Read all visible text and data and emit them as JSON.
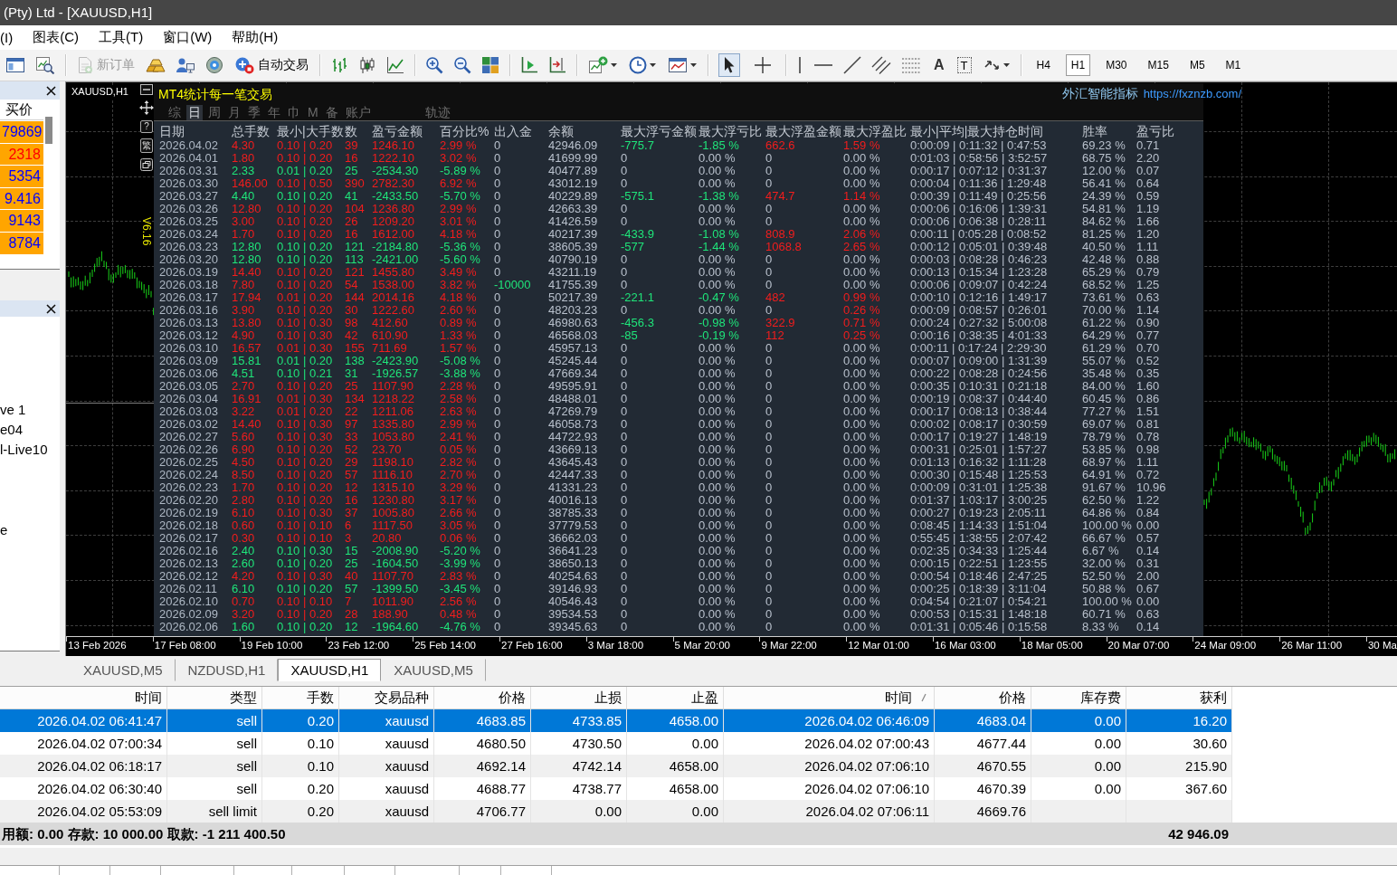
{
  "window": {
    "title": "(Pty) Ltd - [XAUUSD,H1]"
  },
  "menu": [
    "(I)",
    "图表(C)",
    "工具(T)",
    "窗口(W)",
    "帮助(H)"
  ],
  "toolbar": {
    "new_order": {
      "label": "新订单",
      "disabled": true
    },
    "auto_trading": "自动交易",
    "pointer_modes": [
      {
        "selected": true
      },
      {
        "selected": false
      }
    ],
    "text_tool": "A",
    "label_tool": "T",
    "timeframes": [
      {
        "label": "H4",
        "selected": false
      },
      {
        "label": "H1",
        "selected": true
      },
      {
        "label": "M30",
        "selected": false
      },
      {
        "label": "M15",
        "selected": false
      },
      {
        "label": "M5",
        "selected": false
      },
      {
        "label": "M1",
        "selected": false
      }
    ]
  },
  "market_watch": {
    "column": "买价",
    "rows": [
      {
        "bid": "79869",
        "kind": "up"
      },
      {
        "bid": "2318",
        "kind": "down"
      },
      {
        "bid": "5354",
        "kind": "up"
      },
      {
        "bid": "9.416",
        "kind": "up"
      },
      {
        "bid": "9143",
        "kind": "up"
      },
      {
        "bid": "8784",
        "kind": "up"
      }
    ]
  },
  "navigator": {
    "items": [
      "ve 1",
      "e04",
      "l-Live10",
      "e"
    ]
  },
  "chart": {
    "symbol": "XAUUSD,H1",
    "help_button": "?",
    "language_button": "繁",
    "version": "V6.16",
    "time_labels": [
      "13 Feb 2026",
      "17 Feb 08:00",
      "19 Feb 10:00",
      "23 Feb 12:00",
      "25 Feb 14:00",
      "27 Feb 16:00",
      "3 Mar 18:00",
      "5 Mar 20:00",
      "9 Mar 22:00",
      "12 Mar 01:00",
      "16 Mar 03:00",
      "18 Mar 05:00",
      "20 Mar 07:00",
      "24 Mar 09:00",
      "26 Mar 11:00",
      "30 Ma"
    ]
  },
  "stats_panel": {
    "title": "MT4统计每一笔交易",
    "brand": "外汇智能指标",
    "link": "https://fxznzb.com/",
    "tabs": [
      {
        "label": "综",
        "selected": false
      },
      {
        "label": "日",
        "selected": true
      },
      {
        "label": "周",
        "selected": false
      },
      {
        "label": "月",
        "selected": false
      },
      {
        "label": "季",
        "selected": false
      },
      {
        "label": "年",
        "selected": false
      },
      {
        "label": "巾",
        "selected": false
      },
      {
        "label": "M",
        "selected": false
      },
      {
        "label": "备",
        "selected": false
      },
      {
        "label": "账户",
        "selected": false
      },
      {
        "label": "轨迹",
        "selected": false
      }
    ],
    "columns": [
      "日期",
      "总手数",
      "最小|大手数",
      "数",
      "盈亏金额",
      "百分比%",
      "出入金",
      "余额",
      "最大浮亏金额",
      "最大浮亏比",
      "最大浮盈金额",
      "最大浮盈比",
      "最小|平均|最大持仓时间",
      "胜率",
      "盈亏比"
    ],
    "rows": [
      {
        "date": "2026.04.02",
        "kind": "profit",
        "lots": "4.30",
        "lot_range": "0.10 | 0.20",
        "trades": "39",
        "pnl": "1246.10",
        "pct": "2.99 %",
        "deposit": "0",
        "deposit_marked": false,
        "balance": "42946.09",
        "float_loss": "-775.7",
        "float_loss_pct": "-1.85 %",
        "float_loss_marked": true,
        "float_profit": "662.6",
        "float_profit_marked": true,
        "float_profit_pct": "1.59 %",
        "float_profit_pct_marked": true,
        "hold_times": "0:00:09 | 0:11:32 | 0:47:53",
        "win_rate": "69.23 %",
        "profit_factor": "0.71"
      },
      {
        "date": "2026.04.01",
        "kind": "profit",
        "lots": "1.80",
        "lot_range": "0.10 | 0.20",
        "trades": "16",
        "pnl": "1222.10",
        "pct": "3.02 %",
        "deposit": "0",
        "deposit_marked": false,
        "balance": "41699.99",
        "float_loss": "0",
        "float_loss_pct": "0.00 %",
        "float_loss_marked": false,
        "float_profit": "0",
        "float_profit_marked": false,
        "float_profit_pct": "0.00 %",
        "float_profit_pct_marked": false,
        "hold_times": "0:01:03 | 0:58:56 | 3:52:57",
        "win_rate": "68.75 %",
        "profit_factor": "2.20"
      },
      {
        "date": "2026.03.31",
        "kind": "loss",
        "lots": "2.33",
        "lot_range": "0.01 | 0.20",
        "trades": "25",
        "pnl": "-2534.30",
        "pct": "-5.89 %",
        "deposit": "0",
        "deposit_marked": false,
        "balance": "40477.89",
        "float_loss": "0",
        "float_loss_pct": "0.00 %",
        "float_loss_marked": false,
        "float_profit": "0",
        "float_profit_marked": false,
        "float_profit_pct": "0.00 %",
        "float_profit_pct_marked": false,
        "hold_times": "0:00:17 | 0:07:12 | 0:31:37",
        "win_rate": "12.00 %",
        "profit_factor": "0.07"
      },
      {
        "date": "2026.03.30",
        "kind": "profit",
        "lots": "146.00",
        "lot_range": "0.10 | 0.50",
        "trades": "390",
        "pnl": "2782.30",
        "pct": "6.92 %",
        "deposit": "0",
        "deposit_marked": false,
        "balance": "43012.19",
        "float_loss": "0",
        "float_loss_pct": "0.00 %",
        "float_loss_marked": false,
        "float_profit": "0",
        "float_profit_marked": false,
        "float_profit_pct": "0.00 %",
        "float_profit_pct_marked": false,
        "hold_times": "0:00:04 | 0:11:36 | 1:29:48",
        "win_rate": "56.41 %",
        "profit_factor": "0.64"
      },
      {
        "date": "2026.03.27",
        "kind": "loss",
        "lots": "4.40",
        "lot_range": "0.10 | 0.20",
        "trades": "41",
        "pnl": "-2433.50",
        "pct": "-5.70 %",
        "deposit": "0",
        "deposit_marked": false,
        "balance": "40229.89",
        "float_loss": "-575.1",
        "float_loss_pct": "-1.38 %",
        "float_loss_marked": true,
        "float_profit": "474.7",
        "float_profit_marked": true,
        "float_profit_pct": "1.14 %",
        "float_profit_pct_marked": true,
        "hold_times": "0:00:39 | 0:11:49 | 0:25:56",
        "win_rate": "24.39 %",
        "profit_factor": "0.59"
      },
      {
        "date": "2026.03.26",
        "kind": "profit",
        "lots": "12.80",
        "lot_range": "0.10 | 0.20",
        "trades": "104",
        "pnl": "1236.80",
        "pct": "2.99 %",
        "deposit": "0",
        "deposit_marked": false,
        "balance": "42663.39",
        "float_loss": "0",
        "float_loss_pct": "0.00 %",
        "float_loss_marked": false,
        "float_profit": "0",
        "float_profit_marked": false,
        "float_profit_pct": "0.00 %",
        "float_profit_pct_marked": false,
        "hold_times": "0:00:06 | 0:16:06 | 1:39:31",
        "win_rate": "54.81 %",
        "profit_factor": "1.19"
      },
      {
        "date": "2026.03.25",
        "kind": "profit",
        "lots": "3.00",
        "lot_range": "0.10 | 0.20",
        "trades": "26",
        "pnl": "1209.20",
        "pct": "3.01 %",
        "deposit": "0",
        "deposit_marked": false,
        "balance": "41426.59",
        "float_loss": "0",
        "float_loss_pct": "0.00 %",
        "float_loss_marked": false,
        "float_profit": "0",
        "float_profit_marked": false,
        "float_profit_pct": "0.00 %",
        "float_profit_pct_marked": false,
        "hold_times": "0:00:06 | 0:06:38 | 0:28:11",
        "win_rate": "84.62 %",
        "profit_factor": "1.66"
      },
      {
        "date": "2026.03.24",
        "kind": "profit",
        "lots": "1.70",
        "lot_range": "0.10 | 0.20",
        "trades": "16",
        "pnl": "1612.00",
        "pct": "4.18 %",
        "deposit": "0",
        "deposit_marked": false,
        "balance": "40217.39",
        "float_loss": "-433.9",
        "float_loss_pct": "-1.08 %",
        "float_loss_marked": true,
        "float_profit": "808.9",
        "float_profit_marked": true,
        "float_profit_pct": "2.06 %",
        "float_profit_pct_marked": true,
        "hold_times": "0:00:11 | 0:05:28 | 0:08:52",
        "win_rate": "81.25 %",
        "profit_factor": "1.20"
      },
      {
        "date": "2026.03.23",
        "kind": "loss",
        "lots": "12.80",
        "lot_range": "0.10 | 0.20",
        "trades": "121",
        "pnl": "-2184.80",
        "pct": "-5.36 %",
        "deposit": "0",
        "deposit_marked": false,
        "balance": "38605.39",
        "float_loss": "-577",
        "float_loss_pct": "-1.44 %",
        "float_loss_marked": true,
        "float_profit": "1068.8",
        "float_profit_marked": true,
        "float_profit_pct": "2.65 %",
        "float_profit_pct_marked": true,
        "hold_times": "0:00:12 | 0:05:01 | 0:39:48",
        "win_rate": "40.50 %",
        "profit_factor": "1.11"
      },
      {
        "date": "2026.03.20",
        "kind": "loss",
        "lots": "12.80",
        "lot_range": "0.10 | 0.20",
        "trades": "113",
        "pnl": "-2421.00",
        "pct": "-5.60 %",
        "deposit": "0",
        "deposit_marked": false,
        "balance": "40790.19",
        "float_loss": "0",
        "float_loss_pct": "0.00 %",
        "float_loss_marked": false,
        "float_profit": "0",
        "float_profit_marked": false,
        "float_profit_pct": "0.00 %",
        "float_profit_pct_marked": false,
        "hold_times": "0:00:03 | 0:08:28 | 0:46:23",
        "win_rate": "42.48 %",
        "profit_factor": "0.88"
      },
      {
        "date": "2026.03.19",
        "kind": "profit",
        "lots": "14.40",
        "lot_range": "0.10 | 0.20",
        "trades": "121",
        "pnl": "1455.80",
        "pct": "3.49 %",
        "deposit": "0",
        "deposit_marked": false,
        "balance": "43211.19",
        "float_loss": "0",
        "float_loss_pct": "0.00 %",
        "float_loss_marked": false,
        "float_profit": "0",
        "float_profit_marked": false,
        "float_profit_pct": "0.00 %",
        "float_profit_pct_marked": false,
        "hold_times": "0:00:13 | 0:15:34 | 1:23:28",
        "win_rate": "65.29 %",
        "profit_factor": "0.79"
      },
      {
        "date": "2026.03.18",
        "kind": "profit",
        "lots": "7.80",
        "lot_range": "0.10 | 0.20",
        "trades": "54",
        "pnl": "1538.00",
        "pct": "3.82 %",
        "deposit": "-10000",
        "deposit_marked": true,
        "balance": "41755.39",
        "float_loss": "0",
        "float_loss_pct": "0.00 %",
        "float_loss_marked": false,
        "float_profit": "0",
        "float_profit_marked": false,
        "float_profit_pct": "0.00 %",
        "float_profit_pct_marked": false,
        "hold_times": "0:00:06 | 0:09:07 | 0:42:24",
        "win_rate": "68.52 %",
        "profit_factor": "1.25"
      },
      {
        "date": "2026.03.17",
        "kind": "profit",
        "lots": "17.94",
        "lot_range": "0.01 | 0.20",
        "trades": "144",
        "pnl": "2014.16",
        "pct": "4.18 %",
        "deposit": "0",
        "deposit_marked": false,
        "balance": "50217.39",
        "float_loss": "-221.1",
        "float_loss_pct": "-0.47 %",
        "float_loss_marked": true,
        "float_profit": "482",
        "float_profit_marked": true,
        "float_profit_pct": "0.99 %",
        "float_profit_pct_marked": true,
        "hold_times": "0:00:10 | 0:12:16 | 1:49:17",
        "win_rate": "73.61 %",
        "profit_factor": "0.63"
      },
      {
        "date": "2026.03.16",
        "kind": "profit",
        "lots": "3.90",
        "lot_range": "0.10 | 0.20",
        "trades": "30",
        "pnl": "1222.60",
        "pct": "2.60 %",
        "deposit": "0",
        "deposit_marked": false,
        "balance": "48203.23",
        "float_loss": "0",
        "float_loss_pct": "0.00 %",
        "float_loss_marked": false,
        "float_profit": "0",
        "float_profit_marked": false,
        "float_profit_pct": "0.26 %",
        "float_profit_pct_marked": true,
        "hold_times": "0:00:09 | 0:08:57 | 0:26:01",
        "win_rate": "70.00 %",
        "profit_factor": "1.14"
      },
      {
        "date": "2026.03.13",
        "kind": "profit",
        "lots": "13.80",
        "lot_range": "0.10 | 0.30",
        "trades": "98",
        "pnl": "412.60",
        "pct": "0.89 %",
        "deposit": "0",
        "deposit_marked": false,
        "balance": "46980.63",
        "float_loss": "-456.3",
        "float_loss_pct": "-0.98 %",
        "float_loss_marked": true,
        "float_profit": "322.9",
        "float_profit_marked": true,
        "float_profit_pct": "0.71 %",
        "float_profit_pct_marked": true,
        "hold_times": "0:00:24 | 0:27:32 | 5:00:08",
        "win_rate": "61.22 %",
        "profit_factor": "0.90"
      },
      {
        "date": "2026.03.12",
        "kind": "profit",
        "lots": "4.90",
        "lot_range": "0.10 | 0.30",
        "trades": "42",
        "pnl": "610.90",
        "pct": "1.33 %",
        "deposit": "0",
        "deposit_marked": false,
        "balance": "46568.03",
        "float_loss": "-85",
        "float_loss_pct": "-0.19 %",
        "float_loss_marked": true,
        "float_profit": "112",
        "float_profit_marked": true,
        "float_profit_pct": "0.25 %",
        "float_profit_pct_marked": true,
        "hold_times": "0:00:16 | 0:38:35 | 4:01:33",
        "win_rate": "64.29 %",
        "profit_factor": "0.77"
      },
      {
        "date": "2026.03.10",
        "kind": "profit",
        "lots": "16.57",
        "lot_range": "0.01 | 0.30",
        "trades": "155",
        "pnl": "711.69",
        "pct": "1.57 %",
        "deposit": "0",
        "deposit_marked": false,
        "balance": "45957.13",
        "float_loss": "0",
        "float_loss_pct": "0.00 %",
        "float_loss_marked": false,
        "float_profit": "0",
        "float_profit_marked": false,
        "float_profit_pct": "0.00 %",
        "float_profit_pct_marked": false,
        "hold_times": "0:00:11 | 0:17:24 | 2:29:30",
        "win_rate": "61.29 %",
        "profit_factor": "0.70"
      },
      {
        "date": "2026.03.09",
        "kind": "loss",
        "lots": "15.81",
        "lot_range": "0.01 | 0.20",
        "trades": "138",
        "pnl": "-2423.90",
        "pct": "-5.08 %",
        "deposit": "0",
        "deposit_marked": false,
        "balance": "45245.44",
        "float_loss": "0",
        "float_loss_pct": "0.00 %",
        "float_loss_marked": false,
        "float_profit": "0",
        "float_profit_marked": false,
        "float_profit_pct": "0.00 %",
        "float_profit_pct_marked": false,
        "hold_times": "0:00:07 | 0:09:00 | 1:31:39",
        "win_rate": "55.07 %",
        "profit_factor": "0.52"
      },
      {
        "date": "2026.03.06",
        "kind": "loss",
        "lots": "4.51",
        "lot_range": "0.10 | 0.21",
        "trades": "31",
        "pnl": "-1926.57",
        "pct": "-3.88 %",
        "deposit": "0",
        "deposit_marked": false,
        "balance": "47669.34",
        "float_loss": "0",
        "float_loss_pct": "0.00 %",
        "float_loss_marked": false,
        "float_profit": "0",
        "float_profit_marked": false,
        "float_profit_pct": "0.00 %",
        "float_profit_pct_marked": false,
        "hold_times": "0:00:22 | 0:08:28 | 0:24:56",
        "win_rate": "35.48 %",
        "profit_factor": "0.35"
      },
      {
        "date": "2026.03.05",
        "kind": "profit",
        "lots": "2.70",
        "lot_range": "0.10 | 0.20",
        "trades": "25",
        "pnl": "1107.90",
        "pct": "2.28 %",
        "deposit": "0",
        "deposit_marked": false,
        "balance": "49595.91",
        "float_loss": "0",
        "float_loss_pct": "0.00 %",
        "float_loss_marked": false,
        "float_profit": "0",
        "float_profit_marked": false,
        "float_profit_pct": "0.00 %",
        "float_profit_pct_marked": false,
        "hold_times": "0:00:35 | 0:10:31 | 0:21:18",
        "win_rate": "84.00 %",
        "profit_factor": "1.60"
      },
      {
        "date": "2026.03.04",
        "kind": "profit",
        "lots": "16.91",
        "lot_range": "0.01 | 0.30",
        "trades": "134",
        "pnl": "1218.22",
        "pct": "2.58 %",
        "deposit": "0",
        "deposit_marked": false,
        "balance": "48488.01",
        "float_loss": "0",
        "float_loss_pct": "0.00 %",
        "float_loss_marked": false,
        "float_profit": "0",
        "float_profit_marked": false,
        "float_profit_pct": "0.00 %",
        "float_profit_pct_marked": false,
        "hold_times": "0:00:19 | 0:08:37 | 0:44:40",
        "win_rate": "60.45 %",
        "profit_factor": "0.86"
      },
      {
        "date": "2026.03.03",
        "kind": "profit",
        "lots": "3.22",
        "lot_range": "0.01 | 0.20",
        "trades": "22",
        "pnl": "1211.06",
        "pct": "2.63 %",
        "deposit": "0",
        "deposit_marked": false,
        "balance": "47269.79",
        "float_loss": "0",
        "float_loss_pct": "0.00 %",
        "float_loss_marked": false,
        "float_profit": "0",
        "float_profit_marked": false,
        "float_profit_pct": "0.00 %",
        "float_profit_pct_marked": false,
        "hold_times": "0:00:17 | 0:08:13 | 0:38:44",
        "win_rate": "77.27 %",
        "profit_factor": "1.51"
      },
      {
        "date": "2026.03.02",
        "kind": "profit",
        "lots": "14.40",
        "lot_range": "0.10 | 0.30",
        "trades": "97",
        "pnl": "1335.80",
        "pct": "2.99 %",
        "deposit": "0",
        "deposit_marked": false,
        "balance": "46058.73",
        "float_loss": "0",
        "float_loss_pct": "0.00 %",
        "float_loss_marked": false,
        "float_profit": "0",
        "float_profit_marked": false,
        "float_profit_pct": "0.00 %",
        "float_profit_pct_marked": false,
        "hold_times": "0:00:02 | 0:08:17 | 0:30:59",
        "win_rate": "69.07 %",
        "profit_factor": "0.81"
      },
      {
        "date": "2026.02.27",
        "kind": "profit",
        "lots": "5.60",
        "lot_range": "0.10 | 0.30",
        "trades": "33",
        "pnl": "1053.80",
        "pct": "2.41 %",
        "deposit": "0",
        "deposit_marked": false,
        "balance": "44722.93",
        "float_loss": "0",
        "float_loss_pct": "0.00 %",
        "float_loss_marked": false,
        "float_profit": "0",
        "float_profit_marked": false,
        "float_profit_pct": "0.00 %",
        "float_profit_pct_marked": false,
        "hold_times": "0:00:17 | 0:19:27 | 1:48:19",
        "win_rate": "78.79 %",
        "profit_factor": "0.78"
      },
      {
        "date": "2026.02.26",
        "kind": "profit",
        "lots": "6.90",
        "lot_range": "0.10 | 0.20",
        "trades": "52",
        "pnl": "23.70",
        "pct": "0.05 %",
        "deposit": "0",
        "deposit_marked": false,
        "balance": "43669.13",
        "float_loss": "0",
        "float_loss_pct": "0.00 %",
        "float_loss_marked": false,
        "float_profit": "0",
        "float_profit_marked": false,
        "float_profit_pct": "0.00 %",
        "float_profit_pct_marked": false,
        "hold_times": "0:00:31 | 0:25:01 | 1:57:27",
        "win_rate": "53.85 %",
        "profit_factor": "0.98"
      },
      {
        "date": "2026.02.25",
        "kind": "profit",
        "lots": "4.50",
        "lot_range": "0.10 | 0.20",
        "trades": "29",
        "pnl": "1198.10",
        "pct": "2.82 %",
        "deposit": "0",
        "deposit_marked": false,
        "balance": "43645.43",
        "float_loss": "0",
        "float_loss_pct": "0.00 %",
        "float_loss_marked": false,
        "float_profit": "0",
        "float_profit_marked": false,
        "float_profit_pct": "0.00 %",
        "float_profit_pct_marked": false,
        "hold_times": "0:01:13 | 0:16:32 | 1:11:28",
        "win_rate": "68.97 %",
        "profit_factor": "1.11"
      },
      {
        "date": "2026.02.24",
        "kind": "profit",
        "lots": "8.50",
        "lot_range": "0.10 | 0.20",
        "trades": "57",
        "pnl": "1116.10",
        "pct": "2.70 %",
        "deposit": "0",
        "deposit_marked": false,
        "balance": "42447.33",
        "float_loss": "0",
        "float_loss_pct": "0.00 %",
        "float_loss_marked": false,
        "float_profit": "0",
        "float_profit_marked": false,
        "float_profit_pct": "0.00 %",
        "float_profit_pct_marked": false,
        "hold_times": "0:00:30 | 0:15:48 | 1:25:53",
        "win_rate": "64.91 %",
        "profit_factor": "0.72"
      },
      {
        "date": "2026.02.23",
        "kind": "profit",
        "lots": "1.70",
        "lot_range": "0.10 | 0.20",
        "trades": "12",
        "pnl": "1315.10",
        "pct": "3.29 %",
        "deposit": "0",
        "deposit_marked": false,
        "balance": "41331.23",
        "float_loss": "0",
        "float_loss_pct": "0.00 %",
        "float_loss_marked": false,
        "float_profit": "0",
        "float_profit_marked": false,
        "float_profit_pct": "0.00 %",
        "float_profit_pct_marked": false,
        "hold_times": "0:00:09 | 0:31:01 | 1:25:38",
        "win_rate": "91.67 %",
        "profit_factor": "10.96"
      },
      {
        "date": "2026.02.20",
        "kind": "profit",
        "lots": "2.80",
        "lot_range": "0.10 | 0.20",
        "trades": "16",
        "pnl": "1230.80",
        "pct": "3.17 %",
        "deposit": "0",
        "deposit_marked": false,
        "balance": "40016.13",
        "float_loss": "0",
        "float_loss_pct": "0.00 %",
        "float_loss_marked": false,
        "float_profit": "0",
        "float_profit_marked": false,
        "float_profit_pct": "0.00 %",
        "float_profit_pct_marked": false,
        "hold_times": "0:01:37 | 1:03:17 | 3:00:25",
        "win_rate": "62.50 %",
        "profit_factor": "1.22"
      },
      {
        "date": "2026.02.19",
        "kind": "profit",
        "lots": "6.10",
        "lot_range": "0.10 | 0.30",
        "trades": "37",
        "pnl": "1005.80",
        "pct": "2.66 %",
        "deposit": "0",
        "deposit_marked": false,
        "balance": "38785.33",
        "float_loss": "0",
        "float_loss_pct": "0.00 %",
        "float_loss_marked": false,
        "float_profit": "0",
        "float_profit_marked": false,
        "float_profit_pct": "0.00 %",
        "float_profit_pct_marked": false,
        "hold_times": "0:00:27 | 0:19:23 | 2:05:11",
        "win_rate": "64.86 %",
        "profit_factor": "0.84"
      },
      {
        "date": "2026.02.18",
        "kind": "profit",
        "lots": "0.60",
        "lot_range": "0.10 | 0.10",
        "trades": "6",
        "pnl": "1117.50",
        "pct": "3.05 %",
        "deposit": "0",
        "deposit_marked": false,
        "balance": "37779.53",
        "float_loss": "0",
        "float_loss_pct": "0.00 %",
        "float_loss_marked": false,
        "float_profit": "0",
        "float_profit_marked": false,
        "float_profit_pct": "0.00 %",
        "float_profit_pct_marked": false,
        "hold_times": "0:08:45 | 1:14:33 | 1:51:04",
        "win_rate": "100.00 %",
        "profit_factor": "0.00"
      },
      {
        "date": "2026.02.17",
        "kind": "profit",
        "lots": "0.30",
        "lot_range": "0.10 | 0.10",
        "trades": "3",
        "pnl": "20.80",
        "pct": "0.06 %",
        "deposit": "0",
        "deposit_marked": false,
        "balance": "36662.03",
        "float_loss": "0",
        "float_loss_pct": "0.00 %",
        "float_loss_marked": false,
        "float_profit": "0",
        "float_profit_marked": false,
        "float_profit_pct": "0.00 %",
        "float_profit_pct_marked": false,
        "hold_times": "0:55:45 | 1:38:55 | 2:07:42",
        "win_rate": "66.67 %",
        "profit_factor": "0.57"
      },
      {
        "date": "2026.02.16",
        "kind": "loss",
        "lots": "2.40",
        "lot_range": "0.10 | 0.30",
        "trades": "15",
        "pnl": "-2008.90",
        "pct": "-5.20 %",
        "deposit": "0",
        "deposit_marked": false,
        "balance": "36641.23",
        "float_loss": "0",
        "float_loss_pct": "0.00 %",
        "float_loss_marked": false,
        "float_profit": "0",
        "float_profit_marked": false,
        "float_profit_pct": "0.00 %",
        "float_profit_pct_marked": false,
        "hold_times": "0:02:35 | 0:34:33 | 1:25:44",
        "win_rate": "6.67 %",
        "profit_factor": "0.14"
      },
      {
        "date": "2026.02.13",
        "kind": "loss",
        "lots": "2.60",
        "lot_range": "0.10 | 0.20",
        "trades": "25",
        "pnl": "-1604.50",
        "pct": "-3.99 %",
        "deposit": "0",
        "deposit_marked": false,
        "balance": "38650.13",
        "float_loss": "0",
        "float_loss_pct": "0.00 %",
        "float_loss_marked": false,
        "float_profit": "0",
        "float_profit_marked": false,
        "float_profit_pct": "0.00 %",
        "float_profit_pct_marked": false,
        "hold_times": "0:00:15 | 0:22:51 | 1:23:55",
        "win_rate": "32.00 %",
        "profit_factor": "0.31"
      },
      {
        "date": "2026.02.12",
        "kind": "profit",
        "lots": "4.20",
        "lot_range": "0.10 | 0.30",
        "trades": "40",
        "pnl": "1107.70",
        "pct": "2.83 %",
        "deposit": "0",
        "deposit_marked": false,
        "balance": "40254.63",
        "float_loss": "0",
        "float_loss_pct": "0.00 %",
        "float_loss_marked": false,
        "float_profit": "0",
        "float_profit_marked": false,
        "float_profit_pct": "0.00 %",
        "float_profit_pct_marked": false,
        "hold_times": "0:00:54 | 0:18:46 | 2:47:25",
        "win_rate": "52.50 %",
        "profit_factor": "2.00"
      },
      {
        "date": "2026.02.11",
        "kind": "loss",
        "lots": "6.10",
        "lot_range": "0.10 | 0.20",
        "trades": "57",
        "pnl": "-1399.50",
        "pct": "-3.45 %",
        "deposit": "0",
        "deposit_marked": false,
        "balance": "39146.93",
        "float_loss": "0",
        "float_loss_pct": "0.00 %",
        "float_loss_marked": false,
        "float_profit": "0",
        "float_profit_marked": false,
        "float_profit_pct": "0.00 %",
        "float_profit_pct_marked": false,
        "hold_times": "0:00:25 | 0:18:39 | 3:11:04",
        "win_rate": "50.88 %",
        "profit_factor": "0.67"
      },
      {
        "date": "2026.02.10",
        "kind": "profit",
        "lots": "0.70",
        "lot_range": "0.10 | 0.10",
        "trades": "7",
        "pnl": "1011.90",
        "pct": "2.56 %",
        "deposit": "0",
        "deposit_marked": false,
        "balance": "40546.43",
        "float_loss": "0",
        "float_loss_pct": "0.00 %",
        "float_loss_marked": false,
        "float_profit": "0",
        "float_profit_marked": false,
        "float_profit_pct": "0.00 %",
        "float_profit_pct_marked": false,
        "hold_times": "0:04:54 | 0:21:07 | 0:54:21",
        "win_rate": "100.00 %",
        "profit_factor": "0.00"
      },
      {
        "date": "2026.02.09",
        "kind": "profit",
        "lots": "3.20",
        "lot_range": "0.10 | 0.20",
        "trades": "28",
        "pnl": "188.90",
        "pct": "0.48 %",
        "deposit": "0",
        "deposit_marked": false,
        "balance": "39534.53",
        "float_loss": "0",
        "float_loss_pct": "0.00 %",
        "float_loss_marked": false,
        "float_profit": "0",
        "float_profit_marked": false,
        "float_profit_pct": "0.00 %",
        "float_profit_pct_marked": false,
        "hold_times": "0:00:53 | 0:15:31 | 1:48:18",
        "win_rate": "60.71 %",
        "profit_factor": "0.63"
      },
      {
        "date": "2026.02.06",
        "kind": "loss",
        "lots": "1.60",
        "lot_range": "0.10 | 0.20",
        "trades": "12",
        "pnl": "-1964.60",
        "pct": "-4.76 %",
        "deposit": "0",
        "deposit_marked": false,
        "balance": "39345.63",
        "float_loss": "0",
        "float_loss_pct": "0.00 %",
        "float_loss_marked": false,
        "float_profit": "0",
        "float_profit_marked": false,
        "float_profit_pct": "0.00 %",
        "float_profit_pct_marked": false,
        "hold_times": "0:01:31 | 0:05:46 | 0:15:58",
        "win_rate": "8.33 %",
        "profit_factor": "0.14"
      }
    ]
  },
  "chart_tabs": [
    {
      "label": "XAUUSD,M5",
      "selected": false
    },
    {
      "label": "NZDUSD,H1",
      "selected": false
    },
    {
      "label": "XAUUSD,H1",
      "selected": true
    },
    {
      "label": "XAUUSD,M5",
      "selected": false
    }
  ],
  "terminal": {
    "columns": [
      {
        "label": "时间",
        "sorted": false
      },
      {
        "label": "类型",
        "sorted": false
      },
      {
        "label": "手数",
        "sorted": false
      },
      {
        "label": "交易品种",
        "sorted": false
      },
      {
        "label": "价格",
        "sorted": false
      },
      {
        "label": "止损",
        "sorted": false
      },
      {
        "label": "止盈",
        "sorted": false
      },
      {
        "label": "时间",
        "sorted": true
      },
      {
        "label": "价格",
        "sorted": false
      },
      {
        "label": "库存费",
        "sorted": false
      },
      {
        "label": "获利",
        "sorted": false
      }
    ],
    "rows": [
      {
        "open_time": "2026.04.02 06:41:47",
        "type": "sell",
        "lots": "0.20",
        "symbol": "xauusd",
        "price": "4683.85",
        "stop_loss": "4733.85",
        "take_profit": "4658.00",
        "close_time": "2026.04.02 06:46:09",
        "close_price": "4683.04",
        "swap": "0.00",
        "profit": "16.20",
        "selected": true
      },
      {
        "open_time": "2026.04.02 07:00:34",
        "type": "sell",
        "lots": "0.10",
        "symbol": "xauusd",
        "price": "4680.50",
        "stop_loss": "4730.50",
        "take_profit": "0.00",
        "close_time": "2026.04.02 07:00:43",
        "close_price": "4677.44",
        "swap": "0.00",
        "profit": "30.60",
        "selected": false
      },
      {
        "open_time": "2026.04.02 06:18:17",
        "type": "sell",
        "lots": "0.10",
        "symbol": "xauusd",
        "price": "4692.14",
        "stop_loss": "4742.14",
        "take_profit": "4658.00",
        "close_time": "2026.04.02 07:06:10",
        "close_price": "4670.55",
        "swap": "0.00",
        "profit": "215.90",
        "selected": false
      },
      {
        "open_time": "2026.04.02 06:30:40",
        "type": "sell",
        "lots": "0.20",
        "symbol": "xauusd",
        "price": "4688.77",
        "stop_loss": "4738.77",
        "take_profit": "4658.00",
        "close_time": "2026.04.02 07:06:10",
        "close_price": "4670.39",
        "swap": "0.00",
        "profit": "367.60",
        "selected": false
      },
      {
        "open_time": "2026.04.02 05:53:09",
        "type": "sell limit",
        "lots": "0.20",
        "symbol": "xauusd",
        "price": "4706.77",
        "stop_loss": "0.00",
        "take_profit": "0.00",
        "close_time": "2026.04.02 07:06:11",
        "close_price": "4669.76",
        "selected": false
      }
    ],
    "summary": {
      "text": "用额: 0.00 存款: 10 000.00 取款: -1 211 400.50",
      "total": "42 946.09"
    }
  }
}
